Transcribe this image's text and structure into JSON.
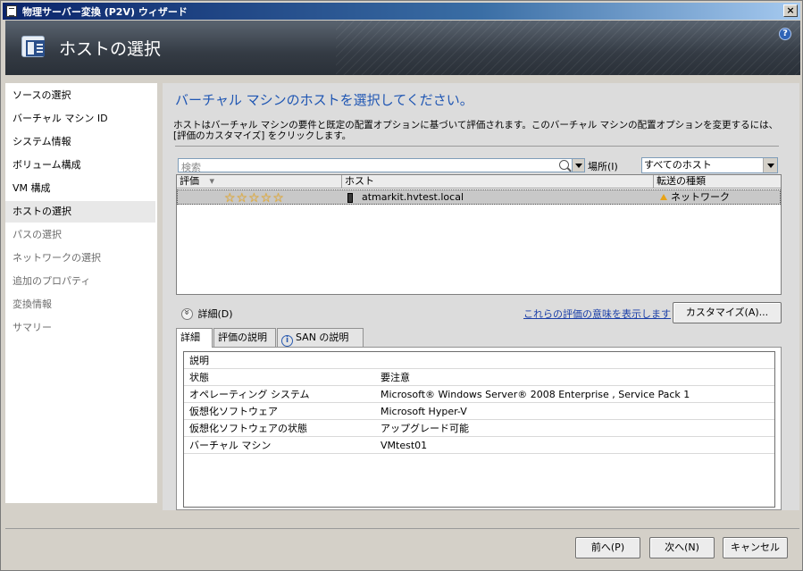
{
  "window": {
    "title": "物理サーバー変換 (P2V) ウィザード",
    "close_glyph": "×"
  },
  "header": {
    "title": "ホストの選択",
    "help_glyph": "?"
  },
  "sidebar": {
    "items": [
      {
        "label": "ソースの選択",
        "state": "normal"
      },
      {
        "label": "バーチャル マシン ID",
        "state": "normal"
      },
      {
        "label": "システム情報",
        "state": "normal"
      },
      {
        "label": "ボリューム構成",
        "state": "normal"
      },
      {
        "label": "VM 構成",
        "state": "normal"
      },
      {
        "label": "ホストの選択",
        "state": "active"
      },
      {
        "label": "パスの選択",
        "state": "disabled"
      },
      {
        "label": "ネットワークの選択",
        "state": "disabled"
      },
      {
        "label": "追加のプロパティ",
        "state": "disabled"
      },
      {
        "label": "変換情報",
        "state": "disabled"
      },
      {
        "label": "サマリー",
        "state": "disabled"
      }
    ]
  },
  "main": {
    "heading": "バーチャル マシンのホストを選択してください。",
    "description": "ホストはバーチャル マシンの要件と既定の配置オプションに基づいて評価されます。このバーチャル マシンの配置オプションを変更するには、[評価のカスタマイズ] をクリックします。",
    "search": {
      "placeholder": "検索"
    },
    "location": {
      "label": "場所(I)",
      "selected": "すべてのホスト"
    },
    "grid": {
      "columns": {
        "rating": "評価",
        "rating_sort": "▾",
        "host": "ホスト",
        "transfer": "転送の種類"
      },
      "rows": [
        {
          "stars": "☆☆☆☆☆",
          "rating": 5,
          "host": "atmarkit.hvtest.local",
          "transfer": "ネットワーク"
        }
      ]
    },
    "details_toggle": "詳細(D)",
    "explain_link": "これらの評価の意味を表示します",
    "customize_button": "カスタマイズ(A)...",
    "tabs": [
      "詳細",
      "評価の説明",
      "SAN の説明"
    ],
    "details": {
      "rows": [
        {
          "key": "説明",
          "value": ""
        },
        {
          "key": "状態",
          "value": "要注意"
        },
        {
          "key": "オペレーティング システム",
          "value": "Microsoft® Windows Server® 2008 Enterprise , Service Pack 1"
        },
        {
          "key": "仮想化ソフトウェア",
          "value": "Microsoft Hyper-V"
        },
        {
          "key": "仮想化ソフトウェアの状態",
          "value": "アップグレード可能"
        },
        {
          "key": "バーチャル マシン",
          "value": "VMtest01"
        }
      ]
    }
  },
  "footer": {
    "prev": "前へ(P)",
    "next": "次へ(N)",
    "cancel": "キャンセル"
  }
}
